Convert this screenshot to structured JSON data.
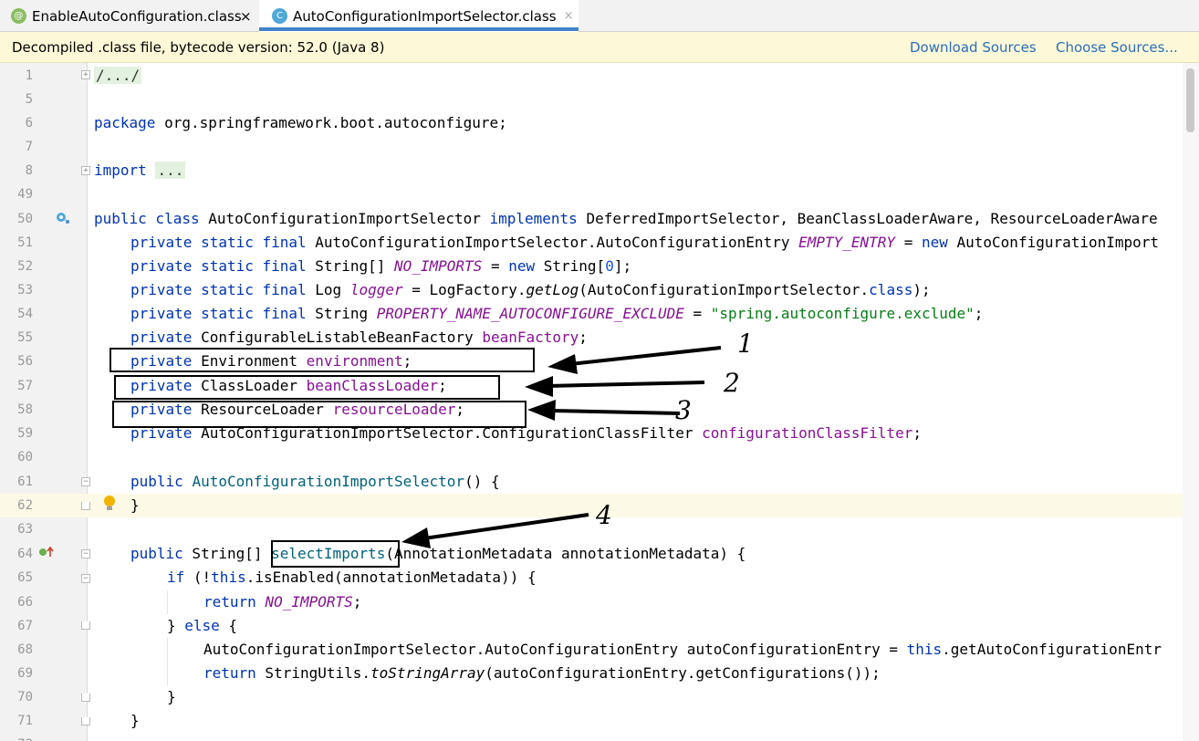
{
  "tabs": [
    {
      "icon": "@",
      "label": "EnableAutoConfiguration.class",
      "close": "×",
      "active": false
    },
    {
      "icon": "C",
      "label": "AutoConfigurationImportSelector.class",
      "close": "×",
      "active": true
    }
  ],
  "banner": {
    "message": "Decompiled .class file, bytecode version: 52.0 (Java 8)",
    "download_sources": "Download Sources",
    "choose_sources": "Choose Sources..."
  },
  "editor": {
    "line_numbers": [
      "1",
      "5",
      "6",
      "7",
      "8",
      "49",
      "50",
      "51",
      "52",
      "53",
      "54",
      "55",
      "56",
      "57",
      "58",
      "59",
      "60",
      "61",
      "62",
      "63",
      "64",
      "65",
      "66",
      "67",
      "68",
      "69",
      "70",
      "71",
      "72"
    ],
    "lines": {
      "l1_fold": "/.../",
      "l6_kw": "package",
      "l6_rest": " org.springframework.boot.autoconfigure;",
      "l8_kw": "import",
      "l8_fold": "...",
      "l50_kw1": "public class",
      "l50_name": " AutoConfigurationImportSelector ",
      "l50_kw2": "implements",
      "l50_rest": " DeferredImportSelector, BeanClassLoaderAware, ResourceLoaderAware",
      "l51_kw": "private static final",
      "l51_type": " AutoConfigurationImportSelector.AutoConfigurationEntry ",
      "l51_field": "EMPTY_ENTRY",
      "l51_eq": " = ",
      "l51_new": "new",
      "l51_rest": " AutoConfigurationImport",
      "l52_kw": "private static final",
      "l52_type": " String[] ",
      "l52_field": "NO_IMPORTS",
      "l52_eq": " = ",
      "l52_new": "new",
      "l52_a": " String[",
      "l52_num": "0",
      "l52_b": "];",
      "l53_kw": "private static final",
      "l53_type": " Log ",
      "l53_field": "logger",
      "l53_a": " = LogFactory.",
      "l53_call": "getLog",
      "l53_b": "(AutoConfigurationImportSelector.",
      "l53_class": "class",
      "l53_c": ");",
      "l54_kw": "private static final",
      "l54_type": " String ",
      "l54_field": "PROPERTY_NAME_AUTOCONFIGURE_EXCLUDE",
      "l54_eq": " = ",
      "l54_str": "\"spring.autoconfigure.exclude\"",
      "l54_end": ";",
      "l55_kw": "private",
      "l55_type": " ConfigurableListableBeanFactory ",
      "l55_field": "beanFactory",
      "l55_end": ";",
      "l56_kw": "private",
      "l56_type": " Environment ",
      "l56_field": "environment",
      "l56_end": ";",
      "l57_kw": "private",
      "l57_type": " ClassLoader ",
      "l57_field": "beanClassLoader",
      "l57_end": ";",
      "l58_kw": "private",
      "l58_type": " ResourceLoader ",
      "l58_field": "resourceLoader",
      "l58_end": ";",
      "l59_kw": "private",
      "l59_type": " AutoConfigurationImportSelector.ConfigurationClassFilter ",
      "l59_field": "configurationClassFilter",
      "l59_end": ";",
      "l61_kw": "public",
      "l61_name": "AutoConfigurationImportSelector",
      "l61_end": "() {",
      "l62": "}",
      "l64_kw": "public",
      "l64_type": " String[] ",
      "l64_name": "selectImports",
      "l64_rest": "(AnnotationMetadata annotationMetadata) {",
      "l65_kw": "if",
      "l65_a": " (!",
      "l65_this": "this",
      "l65_b": ".isEnabled(annotationMetadata)) {",
      "l66_kw": "return",
      "l66_field": "NO_IMPORTS",
      "l66_end": ";",
      "l67_a": "} ",
      "l67_kw": "else",
      "l67_b": " {",
      "l68_a": "AutoConfigurationImportSelector.AutoConfigurationEntry autoConfigurationEntry = ",
      "l68_this": "this",
      "l68_b": ".getAutoConfigurationEntr",
      "l69_kw": "return",
      "l69_a": " StringUtils.",
      "l69_call": "toStringArray",
      "l69_b": "(autoConfigurationEntry.getConfigurations());",
      "l70": "}",
      "l71": "}"
    }
  },
  "annotations": [
    "1",
    "2",
    "3",
    "4"
  ],
  "colors": {
    "keyword": "#0033b3",
    "field": "#871094",
    "string": "#067d17",
    "number": "#1750eb",
    "declaration": "#00627a",
    "link": "#2a6ebd",
    "banner_bg": "#fdf8d8"
  },
  "icons": [
    "annotation-class-icon",
    "class-icon",
    "close-icon",
    "implements-marker-icon",
    "override-marker-icon",
    "lightbulb-icon",
    "fold-icon"
  ]
}
